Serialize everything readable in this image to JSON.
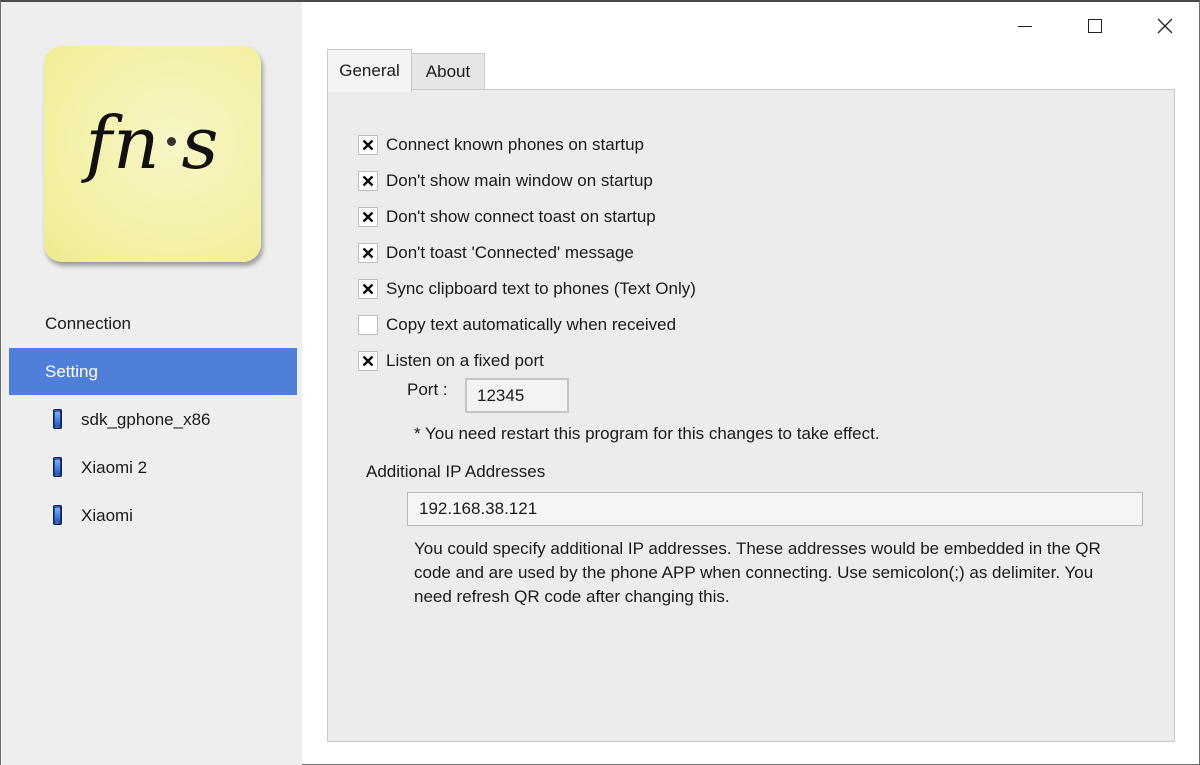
{
  "window": {
    "controls": {
      "minimize": "minimize",
      "maximize": "maximize",
      "close": "close"
    }
  },
  "sidebar": {
    "logo_text": {
      "left": "fn",
      "right": "s"
    },
    "nav": [
      {
        "label": "Connection",
        "active": false
      },
      {
        "label": "Setting",
        "active": true
      }
    ],
    "devices": [
      {
        "label": "sdk_gphone_x86",
        "icon": "phone-icon"
      },
      {
        "label": "Xiaomi 2",
        "icon": "phone-icon"
      },
      {
        "label": "Xiaomi",
        "icon": "phone-icon"
      }
    ],
    "active_color": "#4f7fd9"
  },
  "tabs": [
    {
      "label": "General",
      "selected": true
    },
    {
      "label": "About",
      "selected": false
    }
  ],
  "general": {
    "options": [
      {
        "label": "Connect known phones on startup",
        "checked": true
      },
      {
        "label": "Don't show main window on startup",
        "checked": true
      },
      {
        "label": "Don't show connect toast on startup",
        "checked": true
      },
      {
        "label": "Don't toast 'Connected' message",
        "checked": true
      },
      {
        "label": "Sync clipboard text to phones (Text Only)",
        "checked": true
      },
      {
        "label": "Copy text automatically when received",
        "checked": false
      },
      {
        "label": "Listen on a fixed port",
        "checked": true
      }
    ],
    "port": {
      "label": "Port :",
      "value": "12345"
    },
    "restart_note": "* You need restart this program for this changes to take effect.",
    "additional_ip": {
      "label": "Additional IP Addresses",
      "value": "192.168.38.121",
      "description": "You could specify additional IP addresses. These addresses would be embedded in the QR code and are used by the phone APP when connecting. Use semicolon(;) as delimiter. You need refresh QR code after changing this."
    }
  }
}
